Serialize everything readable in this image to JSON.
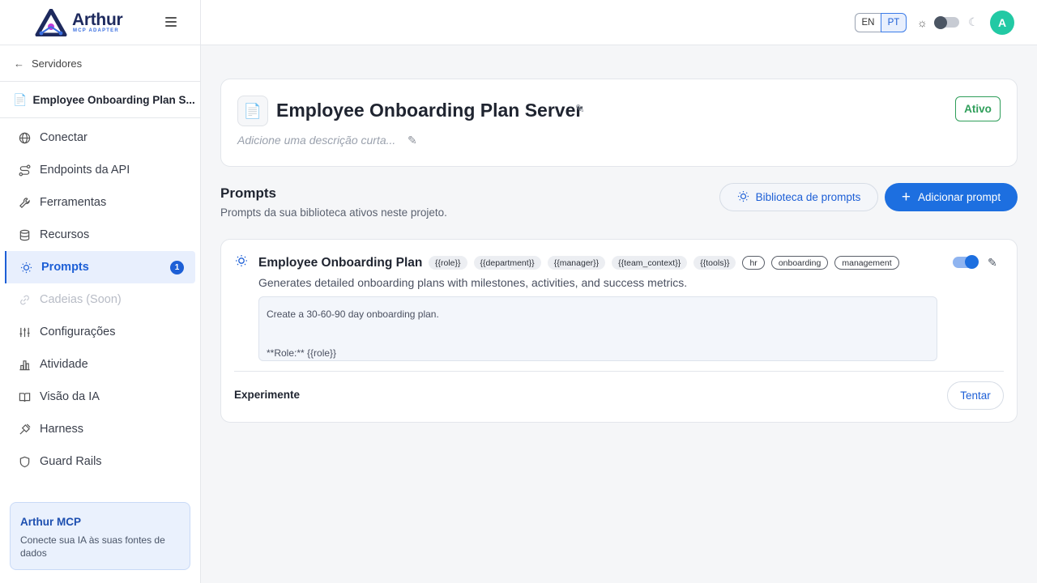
{
  "brand": {
    "name": "Arthur",
    "tagline": "MCP ADAPTER",
    "accent": "#1d5fd6"
  },
  "sidebar": {
    "back_label": "Servidores",
    "server_name": "Employee Onboarding Plan S...",
    "items": [
      {
        "label": "Conectar",
        "icon": "globe-icon"
      },
      {
        "label": "Endpoints da API",
        "icon": "route-icon"
      },
      {
        "label": "Ferramentas",
        "icon": "wrench-icon"
      },
      {
        "label": "Recursos",
        "icon": "database-icon"
      },
      {
        "label": "Prompts",
        "icon": "lightbulb-icon",
        "badge": "1",
        "active": true
      },
      {
        "label": "Cadeias (Soon)",
        "icon": "link-icon",
        "disabled": true
      },
      {
        "label": "Configurações",
        "icon": "sliders-icon"
      },
      {
        "label": "Atividade",
        "icon": "bar-chart-icon"
      },
      {
        "label": "Visão da IA",
        "icon": "book-icon"
      },
      {
        "label": "Harness",
        "icon": "harness-icon"
      },
      {
        "label": "Guard Rails",
        "icon": "shield-icon"
      }
    ],
    "promo": {
      "title": "Arthur MCP",
      "description": "Conecte sua IA às suas fontes de dados"
    }
  },
  "topbar": {
    "lang_en": "EN",
    "lang_pt": "PT",
    "selected_lang": "PT",
    "theme": "light",
    "avatar_initial": "A",
    "avatar_color": "#22c9a4"
  },
  "server": {
    "title": "Employee Onboarding Plan Server",
    "description_placeholder": "Adicione uma descrição curta...",
    "status": "Ativo",
    "status_color": "#2f9e5a"
  },
  "prompts_section": {
    "title": "Prompts",
    "subtitle": "Prompts da sua biblioteca ativos neste projeto.",
    "library_button": "Biblioteca de prompts",
    "add_button": "Adicionar prompt"
  },
  "prompt": {
    "name": "Employee Onboarding Plan",
    "variables": [
      "{{role}}",
      "{{department}}",
      "{{manager}}",
      "{{team_context}}",
      "{{tools}}"
    ],
    "labels": [
      "hr",
      "onboarding",
      "management"
    ],
    "enabled": true,
    "description": "Generates detailed onboarding plans with milestones, activities, and success metrics.",
    "body_line1": "Create a 30-60-90 day onboarding plan.",
    "body_line2": "**Role:** {{role}}",
    "experiment_label": "Experimente",
    "try_button": "Tentar"
  }
}
